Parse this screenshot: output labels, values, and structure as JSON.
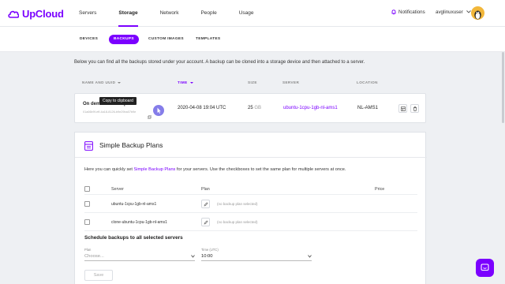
{
  "brand": {
    "name": "UpCloud",
    "color": "#7b00ff"
  },
  "nav": {
    "items": [
      {
        "label": "Servers",
        "active": false
      },
      {
        "label": "Storage",
        "active": true
      },
      {
        "label": "Network",
        "active": false
      },
      {
        "label": "People",
        "active": false
      },
      {
        "label": "Usage",
        "active": false
      }
    ],
    "notifications_label": "Notifications",
    "username": "avglinuxuser"
  },
  "subnav": {
    "tabs": [
      {
        "label": "DEVICES",
        "active": false
      },
      {
        "label": "BACKUPS",
        "active": true
      },
      {
        "label": "CUSTOM IMAGES",
        "active": false
      },
      {
        "label": "TEMPLATES",
        "active": false
      }
    ]
  },
  "backups": {
    "intro": "Below you can find all the backups stored under your account. A backup can be cloned into a storage device and then attached to a server.",
    "columns": {
      "name": "NAME AND UUID",
      "time": "TIME",
      "size": "SIZE",
      "server": "SERVER",
      "location": "LOCATION"
    },
    "rows": [
      {
        "name": "On demand backup",
        "uuid": "01a66b9f-eff-4a18-8126-b9e29ba07b9e",
        "time": "2020-04-08 19:04 UTC",
        "size_value": "25",
        "size_unit": "GB",
        "server": "ubuntu-1cpu-1gb-nl-ams1",
        "location": "NL-AMS1"
      }
    ],
    "tooltip": "Copy to clipboard"
  },
  "plans": {
    "title": "Simple Backup Plans",
    "desc_prefix": "Here you can quickly set ",
    "desc_link": "Simple Backup Plans",
    "desc_suffix": " for your servers. Use the checkboxes to set the same plan for multiple servers at once.",
    "headers": {
      "server": "Server",
      "plan": "Plan",
      "price": "Price"
    },
    "servers": [
      {
        "name": "ubuntu-1cpu-1gb-nl-ams1",
        "plan": "(no backup plan selected)"
      },
      {
        "name": "clone-ubuntu-1cpu-1gb-nl-ams1",
        "plan": "(no backup plan selected)"
      }
    ],
    "schedule": {
      "title": "Schedule backups to all selected servers",
      "plan_label": "Plan",
      "plan_value": "Choose...",
      "time_label": "Time (UTC)",
      "time_value": "10:00",
      "save_label": "Save"
    }
  }
}
